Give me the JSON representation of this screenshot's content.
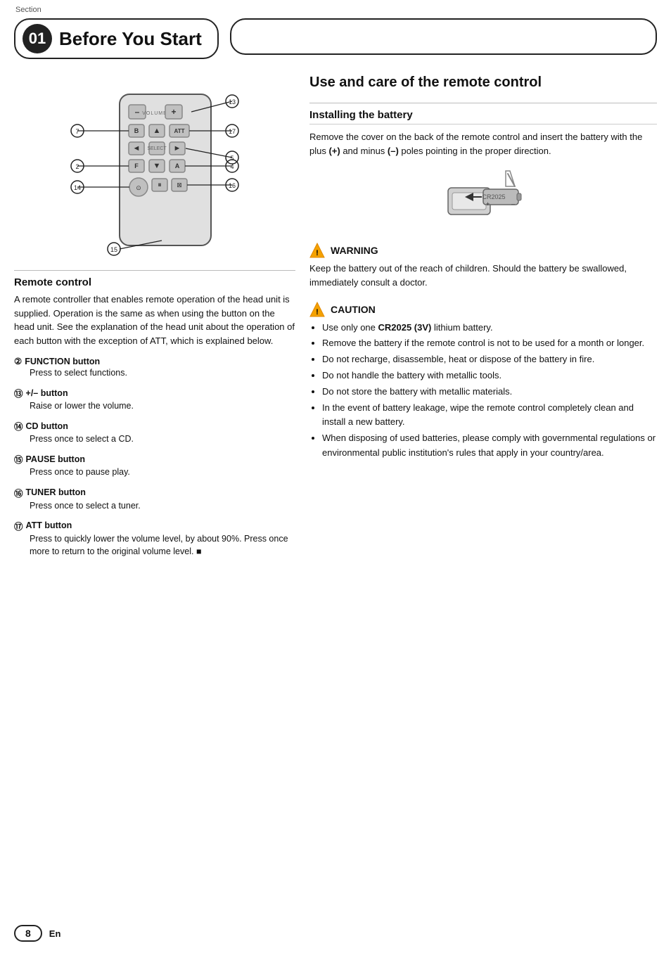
{
  "page": {
    "section_label": "Section",
    "section_number": "01",
    "title": "Before You Start",
    "page_number": "8",
    "page_lang": "En"
  },
  "remote_control": {
    "section_title": "Remote control",
    "section_body": "A remote controller that enables remote operation of the head unit is supplied. Operation is the same as when using the button on the head unit. See the explanation of the head unit about the operation of each button with the exception of ATT, which is explained below.",
    "buttons": [
      {
        "num": "②",
        "label": "FUNCTION button",
        "desc": "Press to select functions."
      },
      {
        "num": "⑬",
        "label": "+/– button",
        "desc": "Raise or lower the volume."
      },
      {
        "num": "⑭",
        "label": "CD button",
        "desc": "Press once to select a CD."
      },
      {
        "num": "⑮",
        "label": "PAUSE button",
        "desc": "Press once to pause play."
      },
      {
        "num": "⑯",
        "label": "TUNER button",
        "desc": "Press once to select a tuner."
      },
      {
        "num": "⑰",
        "label": "ATT button",
        "desc": "Press to quickly lower the volume level, by about 90%. Press once more to return to the original volume level. ■"
      }
    ]
  },
  "use_care": {
    "title": "Use and care of the remote control",
    "installing_title": "Installing the battery",
    "installing_text": "Remove the cover on the back of the remote control and insert the battery with the plus (+) and minus (–) poles pointing in the proper direction."
  },
  "warning": {
    "header": "WARNING",
    "text": "Keep the battery out of the reach of children. Should the battery be swallowed, immediately consult a doctor."
  },
  "caution": {
    "header": "CAUTION",
    "items": [
      "Use only one CR2025 (3V) lithium battery.",
      "Remove the battery if the remote control is not to be used for a month or longer.",
      "Do not recharge, disassemble, heat or dispose of the battery in fire.",
      "Do not handle the battery with metallic tools.",
      "Do not store the battery with metallic materials.",
      "In the event of battery leakage, wipe the remote control completely clean and install a new battery.",
      "When disposing of used batteries, please comply with governmental regulations or environmental public institution's rules that apply in your country/area."
    ]
  },
  "diagram": {
    "labels": {
      "13": "⑬",
      "7": "⑦",
      "17": "⑰",
      "2": "②",
      "5": "⑤",
      "4": "④",
      "14": "⑭",
      "16": "⑯",
      "15": "⑮"
    }
  }
}
